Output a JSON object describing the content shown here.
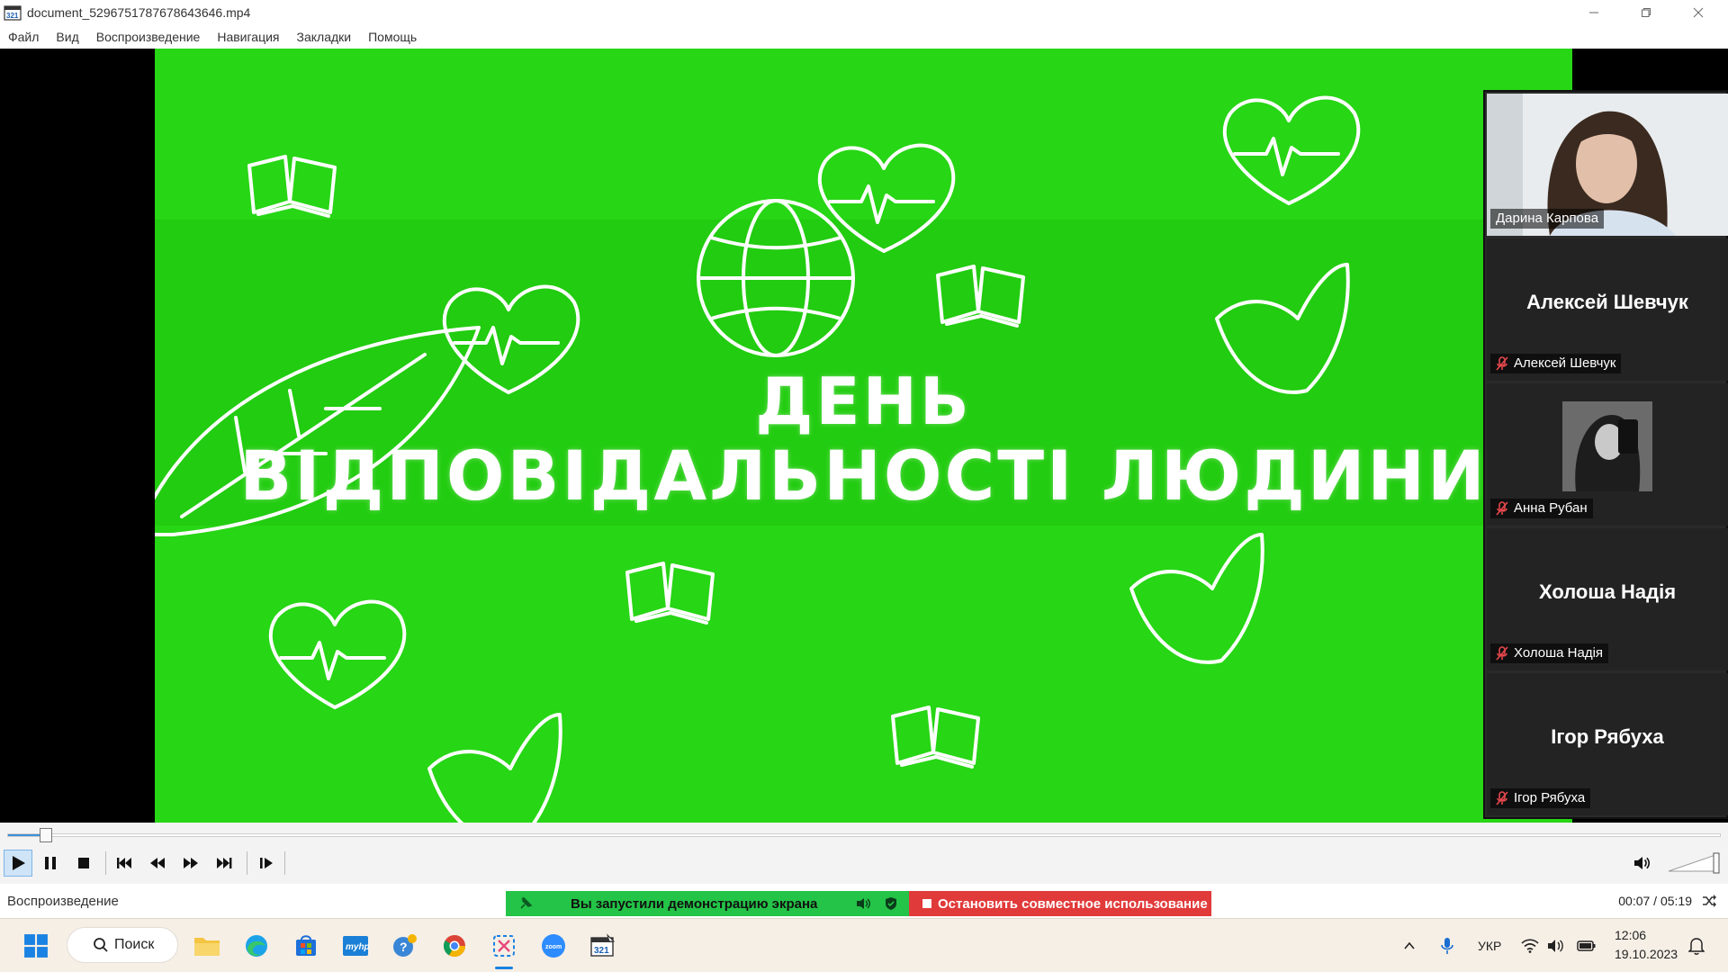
{
  "window": {
    "title": "document_5296751787678643646.mp4"
  },
  "menu": [
    "Файл",
    "Вид",
    "Воспроизведение",
    "Навигация",
    "Закладки",
    "Помощь"
  ],
  "video": {
    "headline_line1": "ДЕНЬ",
    "headline_line2": "ВІДПОВІДАЛЬНОСТІ ЛЮДИНИ",
    "background_color": "#27d615"
  },
  "participants": [
    {
      "name": "Дарина Карпова",
      "type": "camera",
      "muted": false
    },
    {
      "name": "Алексей Шевчук",
      "big_name": "Алексей Шевчук",
      "type": "name",
      "muted": true
    },
    {
      "name": "Анна Рубан",
      "type": "avatar",
      "muted": true
    },
    {
      "name": "Холоша Надія",
      "big_name": "Холоша Надія",
      "type": "name",
      "muted": true
    },
    {
      "name": "Ігор Рябуха",
      "big_name": "Ігор Рябуха",
      "type": "name",
      "muted": true
    }
  ],
  "playback": {
    "progress_fraction": 0.022,
    "status": "Воспроизведение",
    "time": "00:07 / 05:19",
    "volume_icon": "speaker-icon"
  },
  "share_banner": {
    "status_text": "Вы запустили демонстрацию экрана",
    "stop_text": "Остановить совместное использование",
    "green": "#23c447",
    "red": "#e13a3a"
  },
  "taskbar": {
    "search_label": "Поиск",
    "language": "УКР",
    "clock_time": "12:06",
    "clock_date": "19.10.2023"
  }
}
